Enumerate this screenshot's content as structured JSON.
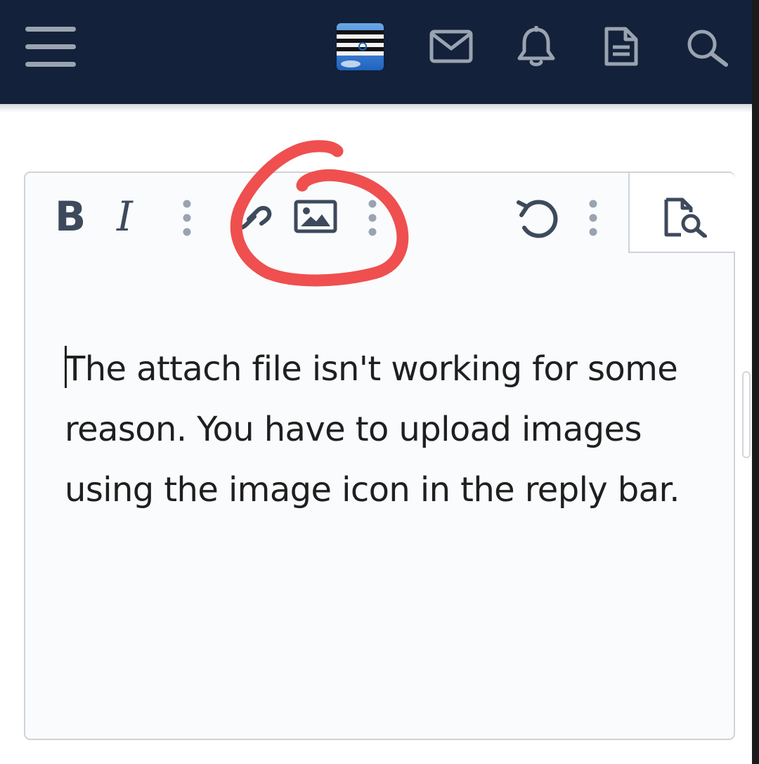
{
  "header": {
    "menu_icon": "hamburger-icon",
    "avatar_icon": "user-avatar",
    "inbox_icon": "envelope-icon",
    "alerts_icon": "bell-icon",
    "whats_new_icon": "document-icon",
    "search_icon": "search-icon",
    "background_color": "#13213a"
  },
  "editor": {
    "toolbar": {
      "bold_label": "B",
      "italic_label": "I",
      "more_text_icon": "vertical-ellipsis-icon",
      "link_icon": "link-icon",
      "image_icon": "image-icon",
      "more_insert_icon": "vertical-ellipsis-icon",
      "undo_icon": "undo-icon",
      "more_options_icon": "vertical-ellipsis-icon",
      "preview_icon": "preview-icon"
    },
    "content": "The attach file isn't working for some reason. You have to upload images using the image icon in the reply bar."
  },
  "annotation": {
    "color": "#ef4f4f",
    "shape": "hand-drawn circle around image icon"
  }
}
